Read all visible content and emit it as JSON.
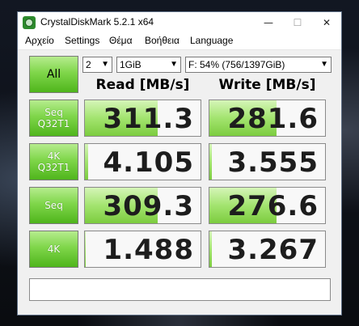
{
  "window": {
    "title": "CrystalDiskMark 5.2.1 x64",
    "min_glyph": "—",
    "max_glyph": "☐",
    "close_glyph": "✕"
  },
  "menu": [
    "Αρχείο",
    "Settings",
    "Θέμα",
    "Βοήθεια",
    "Language"
  ],
  "controls": {
    "all_label": "All",
    "count": "2",
    "size": "1GiB",
    "drive": "F: 54% (756/1397GiB)",
    "dropdown_glyph": "▼"
  },
  "headers": {
    "read": "Read [MB/s]",
    "write": "Write [MB/s]"
  },
  "rows": [
    {
      "label_line1": "Seq",
      "label_line2": "Q32T1",
      "read": "311.3",
      "write": "281.6",
      "read_fill": 0.63,
      "write_fill": 0.58
    },
    {
      "label_line1": "4K",
      "label_line2": "Q32T1",
      "read": "4.105",
      "write": "3.555",
      "read_fill": 0.03,
      "write_fill": 0.02
    },
    {
      "label_line1": "Seq",
      "label_line2": "",
      "read": "309.3",
      "write": "276.6",
      "read_fill": 0.63,
      "write_fill": 0.58
    },
    {
      "label_line1": "4K",
      "label_line2": "",
      "read": "1.488",
      "write": "3.267",
      "read_fill": 0.01,
      "write_fill": 0.02
    }
  ],
  "comment": "",
  "colors": {
    "accent_green": "#7fd64a",
    "bar_fill": "#a3e46f"
  }
}
